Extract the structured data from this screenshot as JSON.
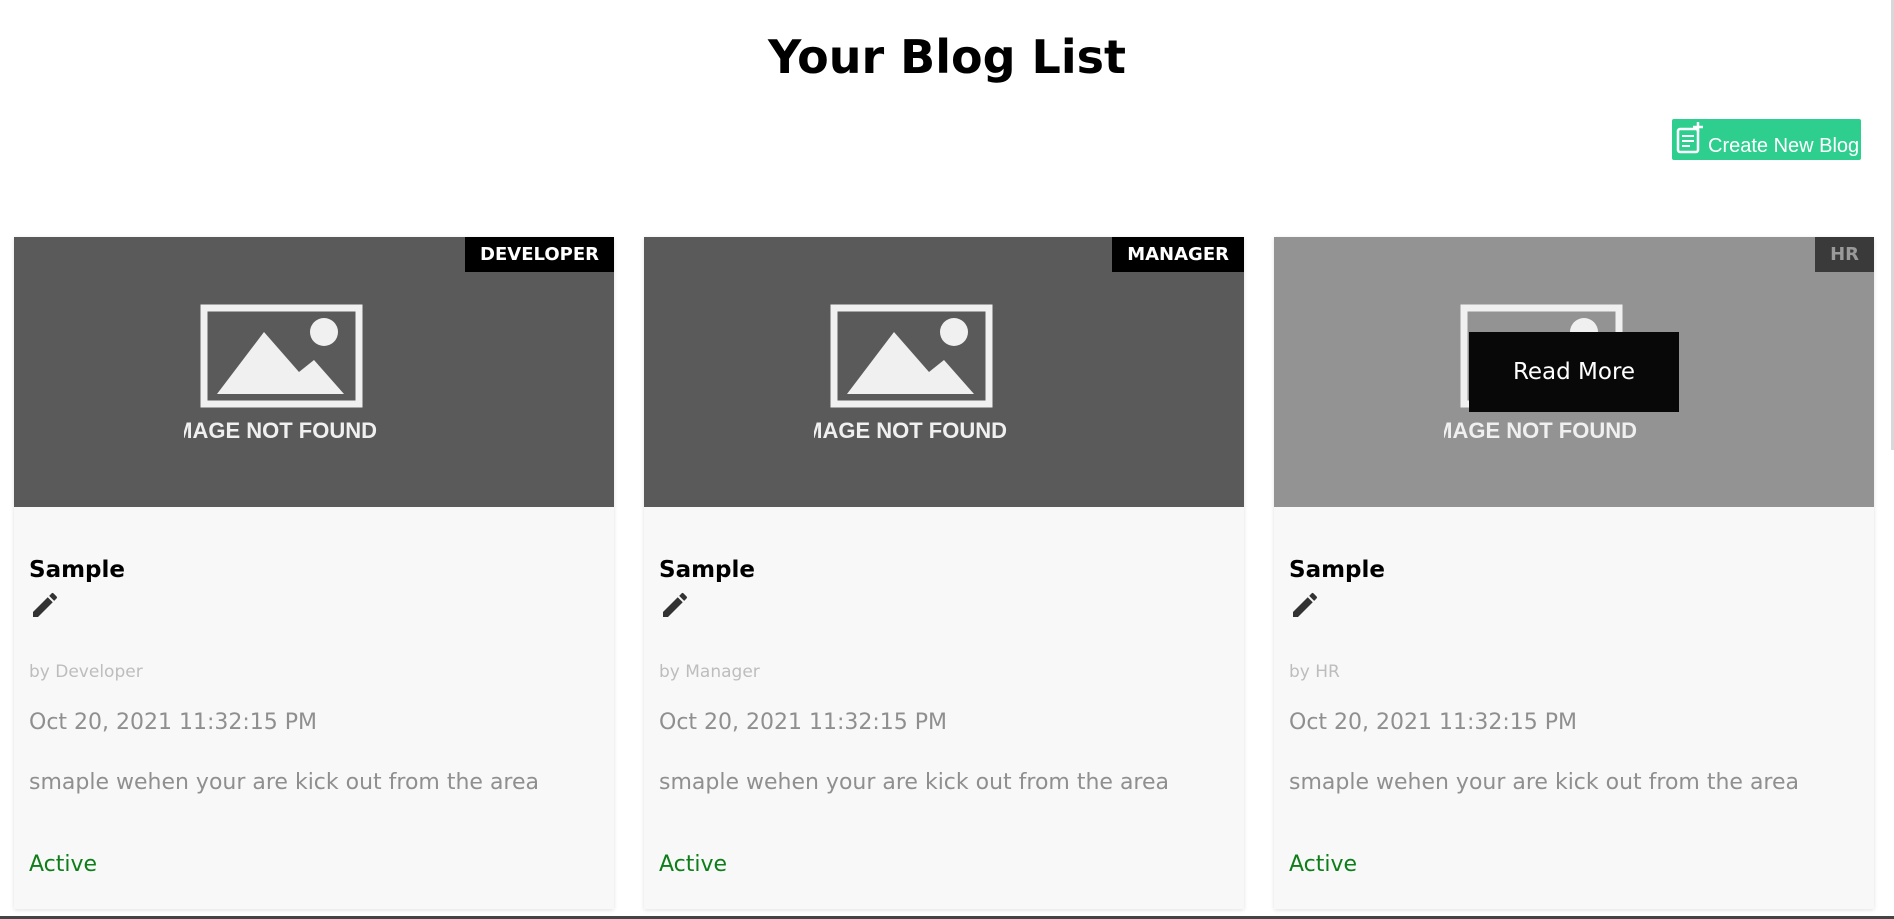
{
  "page": {
    "title": "Your Blog List"
  },
  "toolbar": {
    "create_label": "Create New Blog",
    "create_icon": "add-note-icon",
    "accent": "#2ecf8e"
  },
  "blogs": [
    {
      "tag": "DEVELOPER",
      "image_text": "IMAGE NOT FOUND",
      "title": "Sample",
      "author": "by Developer",
      "date": "Oct 20, 2021 11:32:15 PM",
      "description": "smaple wehen your are kick out from the area",
      "status": "Active"
    },
    {
      "tag": "MANAGER",
      "image_text": "IMAGE NOT FOUND",
      "title": "Sample",
      "author": "by Manager",
      "date": "Oct 20, 2021 11:32:15 PM",
      "description": "smaple wehen your are kick out from the area",
      "status": "Active"
    },
    {
      "tag": "HR",
      "image_text": "IMAGE NOT FOUND",
      "title": "Sample",
      "author": "by HR",
      "date": "Oct 20, 2021 11:32:15 PM",
      "description": "smaple wehen your are kick out from the area",
      "status": "Active",
      "hover_label": "Read More"
    }
  ],
  "colors": {
    "status_active": "#0e7d1a",
    "image_placeholder": "#5a5a5a",
    "image_placeholder_hover": "#939393"
  }
}
